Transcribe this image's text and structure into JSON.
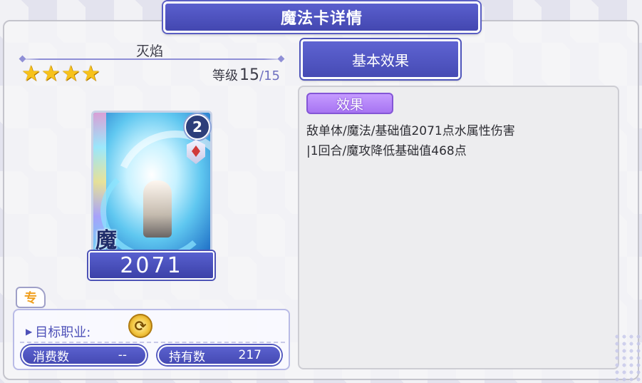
{
  "window": {
    "title": "魔法卡详情"
  },
  "card": {
    "name": "灭焰",
    "stars": 4,
    "star_glyphs": [
      "★",
      "★",
      "★",
      "★"
    ],
    "level_label": "等级",
    "level_current": "15",
    "level_separator": "/",
    "level_max": "15",
    "badge": "2",
    "type_glyph": "魔",
    "value": "2071",
    "exclusive_glyph": "专"
  },
  "info": {
    "target_label": "目标职业:",
    "class_icon_glyph": "⟳",
    "consume_label": "消费数",
    "consume_value": "--",
    "owned_label": "持有数",
    "owned_value": "217"
  },
  "effects": {
    "section_title": "基本效果",
    "tag": "效果",
    "lines": [
      "敌单体/魔法/基础值2071点水属性伤害",
      "|1回合/魔攻降低基础值468点"
    ]
  },
  "colors": {
    "banner": "#4a4fbd",
    "star": "#f7c21b",
    "effect_tag": "#b585f8",
    "text": "#2d2d33"
  }
}
